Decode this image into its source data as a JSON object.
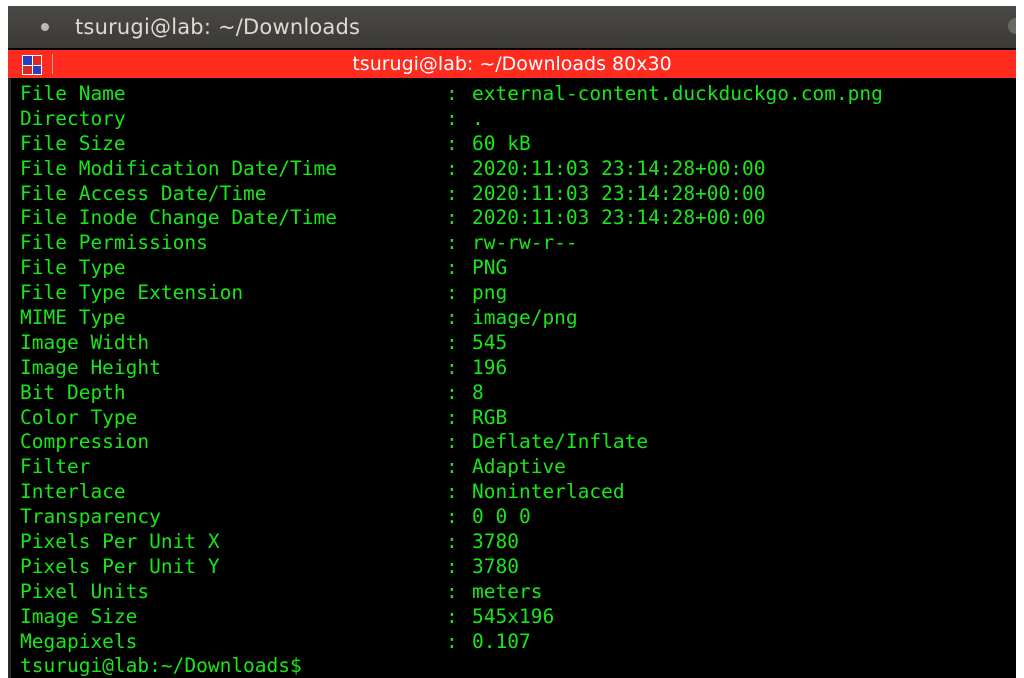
{
  "os_window": {
    "title": "tsurugi@lab: ~/Downloads"
  },
  "terminal": {
    "title": "tsurugi@lab: ~/Downloads 80x30",
    "rows": [
      {
        "key": "File Name",
        "value": "external-content.duckduckgo.com.png"
      },
      {
        "key": "Directory",
        "value": "."
      },
      {
        "key": "File Size",
        "value": "60 kB"
      },
      {
        "key": "File Modification Date/Time",
        "value": "2020:11:03 23:14:28+00:00"
      },
      {
        "key": "File Access Date/Time",
        "value": "2020:11:03 23:14:28+00:00"
      },
      {
        "key": "File Inode Change Date/Time",
        "value": "2020:11:03 23:14:28+00:00"
      },
      {
        "key": "File Permissions",
        "value": "rw-rw-r--"
      },
      {
        "key": "File Type",
        "value": "PNG"
      },
      {
        "key": "File Type Extension",
        "value": "png"
      },
      {
        "key": "MIME Type",
        "value": "image/png"
      },
      {
        "key": "Image Width",
        "value": "545"
      },
      {
        "key": "Image Height",
        "value": "196"
      },
      {
        "key": "Bit Depth",
        "value": "8"
      },
      {
        "key": "Color Type",
        "value": "RGB"
      },
      {
        "key": "Compression",
        "value": "Deflate/Inflate"
      },
      {
        "key": "Filter",
        "value": "Adaptive"
      },
      {
        "key": "Interlace",
        "value": "Noninterlaced"
      },
      {
        "key": "Transparency",
        "value": "0 0 0"
      },
      {
        "key": "Pixels Per Unit X",
        "value": "3780"
      },
      {
        "key": "Pixels Per Unit Y",
        "value": "3780"
      },
      {
        "key": "Pixel Units",
        "value": "meters"
      },
      {
        "key": "Image Size",
        "value": "545x196"
      },
      {
        "key": "Megapixels",
        "value": "0.107"
      }
    ],
    "separator": ":",
    "prompt": "tsurugi@lab:~/Downloads$"
  },
  "colors": {
    "terminal_text": "#19e619",
    "terminal_bg": "#000000",
    "terminal_titlebar": "#ff2b1f"
  }
}
